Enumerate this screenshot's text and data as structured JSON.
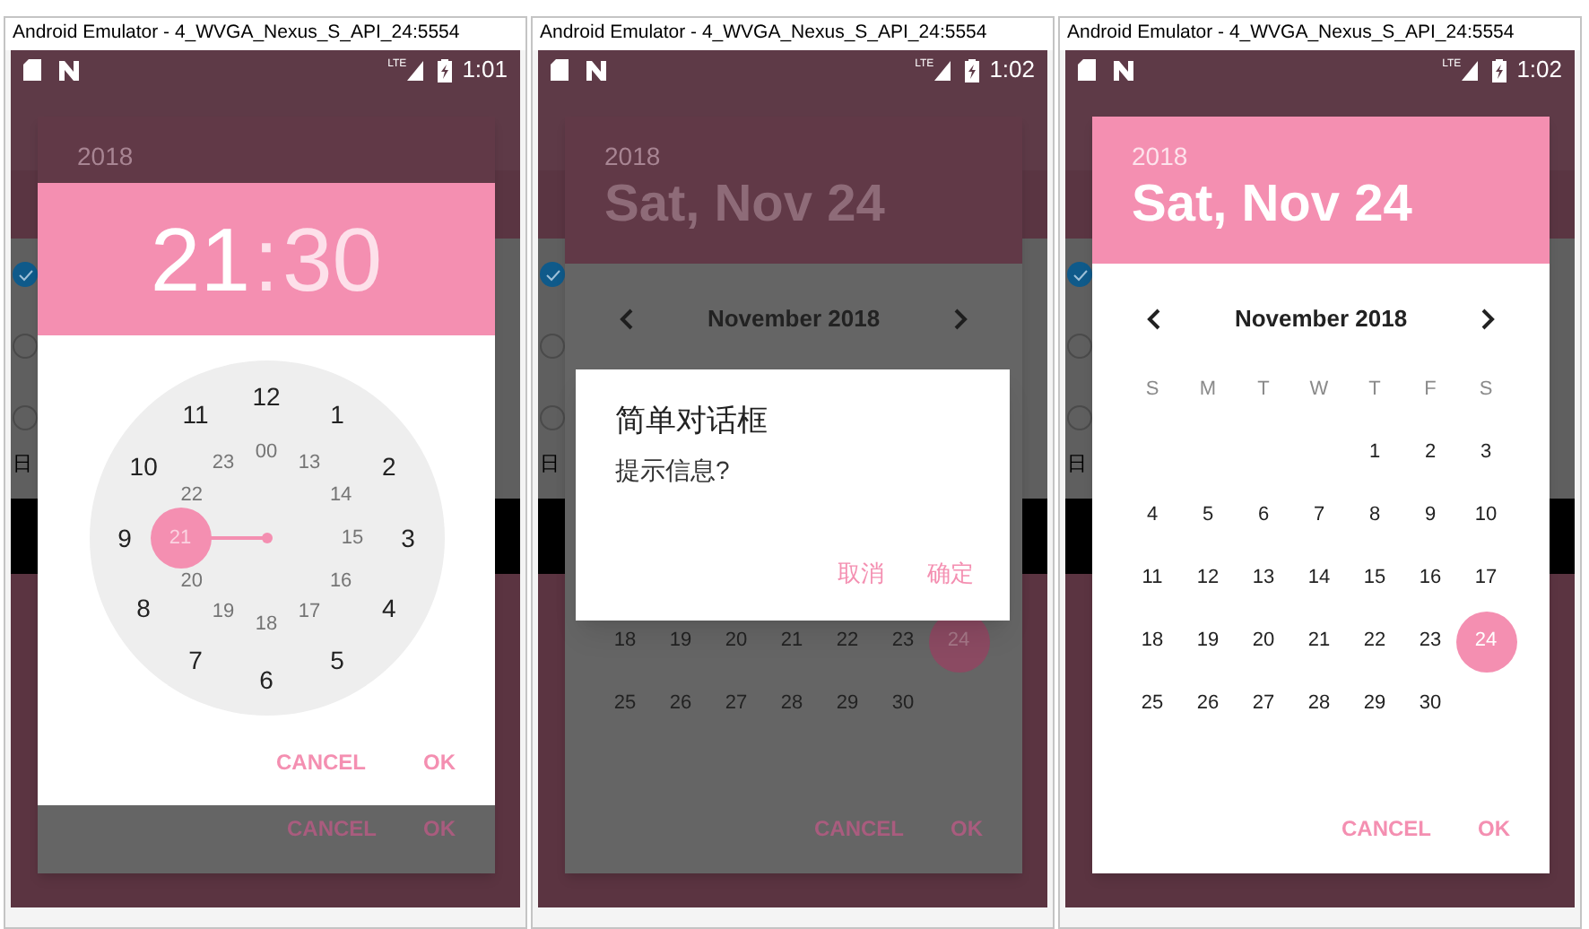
{
  "windows": [
    {
      "title": "Android Emulator - 4_WVGA_Nexus_S_API_24:5554",
      "status_bar": {
        "network": "LTE",
        "time": "1:01"
      },
      "app": {
        "controls": [
          {
            "kind": "checkbox",
            "checked": true
          },
          {
            "kind": "radio",
            "checked": false
          },
          {
            "kind": "radio",
            "checked": false
          }
        ],
        "label": "日"
      },
      "dialogs": [
        {
          "kind": "date_picker",
          "dimmed": true,
          "year": "2018",
          "buttons": [
            "CANCEL",
            "OK"
          ]
        },
        {
          "kind": "time_picker",
          "dimmed": false,
          "hour": {
            "text": "21",
            "selected": true
          },
          "separator": ":",
          "minute": {
            "text": "30",
            "selected": false
          },
          "outer": [
            {
              "text": "12",
              "selected": false
            },
            {
              "text": "1",
              "selected": false
            },
            {
              "text": "2",
              "selected": false
            },
            {
              "text": "3",
              "selected": false
            },
            {
              "text": "4",
              "selected": false
            },
            {
              "text": "5",
              "selected": false
            },
            {
              "text": "6",
              "selected": false
            },
            {
              "text": "7",
              "selected": false
            },
            {
              "text": "8",
              "selected": false
            },
            {
              "text": "9",
              "selected": false
            },
            {
              "text": "10",
              "selected": false
            },
            {
              "text": "11",
              "selected": false
            }
          ],
          "inner": [
            {
              "text": "00",
              "selected": false
            },
            {
              "text": "13",
              "selected": false
            },
            {
              "text": "14",
              "selected": false
            },
            {
              "text": "15",
              "selected": false
            },
            {
              "text": "16",
              "selected": false
            },
            {
              "text": "17",
              "selected": false
            },
            {
              "text": "18",
              "selected": false
            },
            {
              "text": "19",
              "selected": false
            },
            {
              "text": "20",
              "selected": false
            },
            {
              "text": "21",
              "selected": true
            },
            {
              "text": "22",
              "selected": false
            },
            {
              "text": "23",
              "selected": false
            }
          ],
          "buttons": [
            "CANCEL",
            "OK"
          ]
        }
      ]
    },
    {
      "title": "Android Emulator - 4_WVGA_Nexus_S_API_24:5554",
      "status_bar": {
        "network": "LTE",
        "time": "1:02"
      },
      "app": {
        "controls": [
          {
            "kind": "checkbox",
            "checked": true
          },
          {
            "kind": "radio",
            "checked": false
          },
          {
            "kind": "radio",
            "checked": false
          }
        ],
        "label": "日"
      },
      "dialogs": [
        {
          "kind": "date_picker",
          "dimmed": true,
          "year": "2018",
          "date": "Sat, Nov 24",
          "month": "November 2018",
          "weeks": [
            [
              {
                "day": "18",
                "selected": false
              },
              {
                "day": "19",
                "selected": false
              },
              {
                "day": "20",
                "selected": false
              },
              {
                "day": "21",
                "selected": false
              },
              {
                "day": "22",
                "selected": false
              },
              {
                "day": "23",
                "selected": false
              },
              {
                "day": "24",
                "selected": true
              }
            ],
            [
              {
                "day": "25",
                "selected": false
              },
              {
                "day": "26",
                "selected": false
              },
              {
                "day": "27",
                "selected": false
              },
              {
                "day": "28",
                "selected": false
              },
              {
                "day": "29",
                "selected": false
              },
              {
                "day": "30",
                "selected": false
              }
            ]
          ],
          "buttons": [
            "CANCEL",
            "OK"
          ]
        },
        {
          "kind": "alert",
          "dimmed": false,
          "title": "简单对话框",
          "message": "提示信息?",
          "buttons": [
            "取消",
            "确定"
          ]
        }
      ]
    },
    {
      "title": "Android Emulator - 4_WVGA_Nexus_S_API_24:5554",
      "status_bar": {
        "network": "LTE",
        "time": "1:02"
      },
      "app": {
        "controls": [
          {
            "kind": "checkbox",
            "checked": true
          },
          {
            "kind": "radio",
            "checked": false
          },
          {
            "kind": "radio",
            "checked": false
          }
        ],
        "label": "日"
      },
      "dialogs": [
        {
          "kind": "date_picker",
          "dimmed": false,
          "year": "2018",
          "date": "Sat, Nov 24",
          "month": "November 2018",
          "weekdays": [
            "S",
            "M",
            "T",
            "W",
            "T",
            "F",
            "S"
          ],
          "weeks": [
            [
              {
                "day": "1",
                "selected": false
              },
              {
                "day": "2",
                "selected": false
              },
              {
                "day": "3",
                "selected": false
              }
            ],
            [
              {
                "day": "4",
                "selected": false
              },
              {
                "day": "5",
                "selected": false
              },
              {
                "day": "6",
                "selected": false
              },
              {
                "day": "7",
                "selected": false
              },
              {
                "day": "8",
                "selected": false
              },
              {
                "day": "9",
                "selected": false
              },
              {
                "day": "10",
                "selected": false
              }
            ],
            [
              {
                "day": "11",
                "selected": false
              },
              {
                "day": "12",
                "selected": false
              },
              {
                "day": "13",
                "selected": false
              },
              {
                "day": "14",
                "selected": false
              },
              {
                "day": "15",
                "selected": false
              },
              {
                "day": "16",
                "selected": false
              },
              {
                "day": "17",
                "selected": false
              }
            ],
            [
              {
                "day": "18",
                "selected": false
              },
              {
                "day": "19",
                "selected": false
              },
              {
                "day": "20",
                "selected": false
              },
              {
                "day": "21",
                "selected": false
              },
              {
                "day": "22",
                "selected": false
              },
              {
                "day": "23",
                "selected": false
              },
              {
                "day": "24",
                "selected": true
              }
            ],
            [
              {
                "day": "25",
                "selected": false
              },
              {
                "day": "26",
                "selected": false
              },
              {
                "day": "27",
                "selected": false
              },
              {
                "day": "28",
                "selected": false
              },
              {
                "day": "29",
                "selected": false
              },
              {
                "day": "30",
                "selected": false
              }
            ]
          ],
          "buttons": [
            "CANCEL",
            "OK"
          ]
        }
      ]
    }
  ]
}
